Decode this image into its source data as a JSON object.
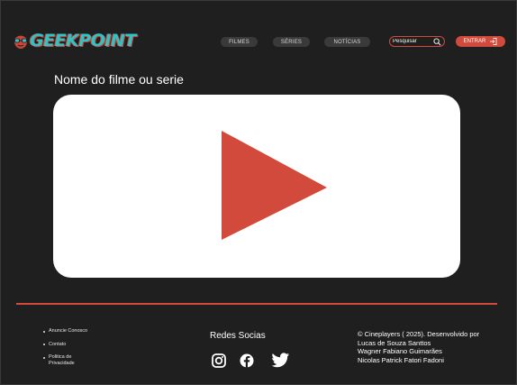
{
  "brand": {
    "logo_text": "GEEKPOINT"
  },
  "nav": {
    "items": [
      {
        "label": "FILMES"
      },
      {
        "label": "SÉRIES"
      },
      {
        "label": "NOTÍCIAS"
      }
    ],
    "search_placeholder": "Pesquisar",
    "login_label": "ENTRAR"
  },
  "main": {
    "title": "Nome do filme ou serie"
  },
  "footer": {
    "links": [
      "Anuncie Conosco",
      "Contato",
      "Politica de Privacidade"
    ],
    "social_title": "Redes Socias",
    "social_icons": [
      "instagram-icon",
      "facebook-icon",
      "twitter-icon"
    ],
    "credits": [
      "© Cineplayers ( 2025). Desenvolvido por",
      "Lucas de Souza Santtos",
      "Wagner Fabiano Guimarães",
      "Nicolas Patrick Fatori Fadoni"
    ]
  },
  "colors": {
    "background": "#1f1f1f",
    "accent": "#d14a3c",
    "logo": "#2ec4c6",
    "pill": "#3a3a3a"
  }
}
